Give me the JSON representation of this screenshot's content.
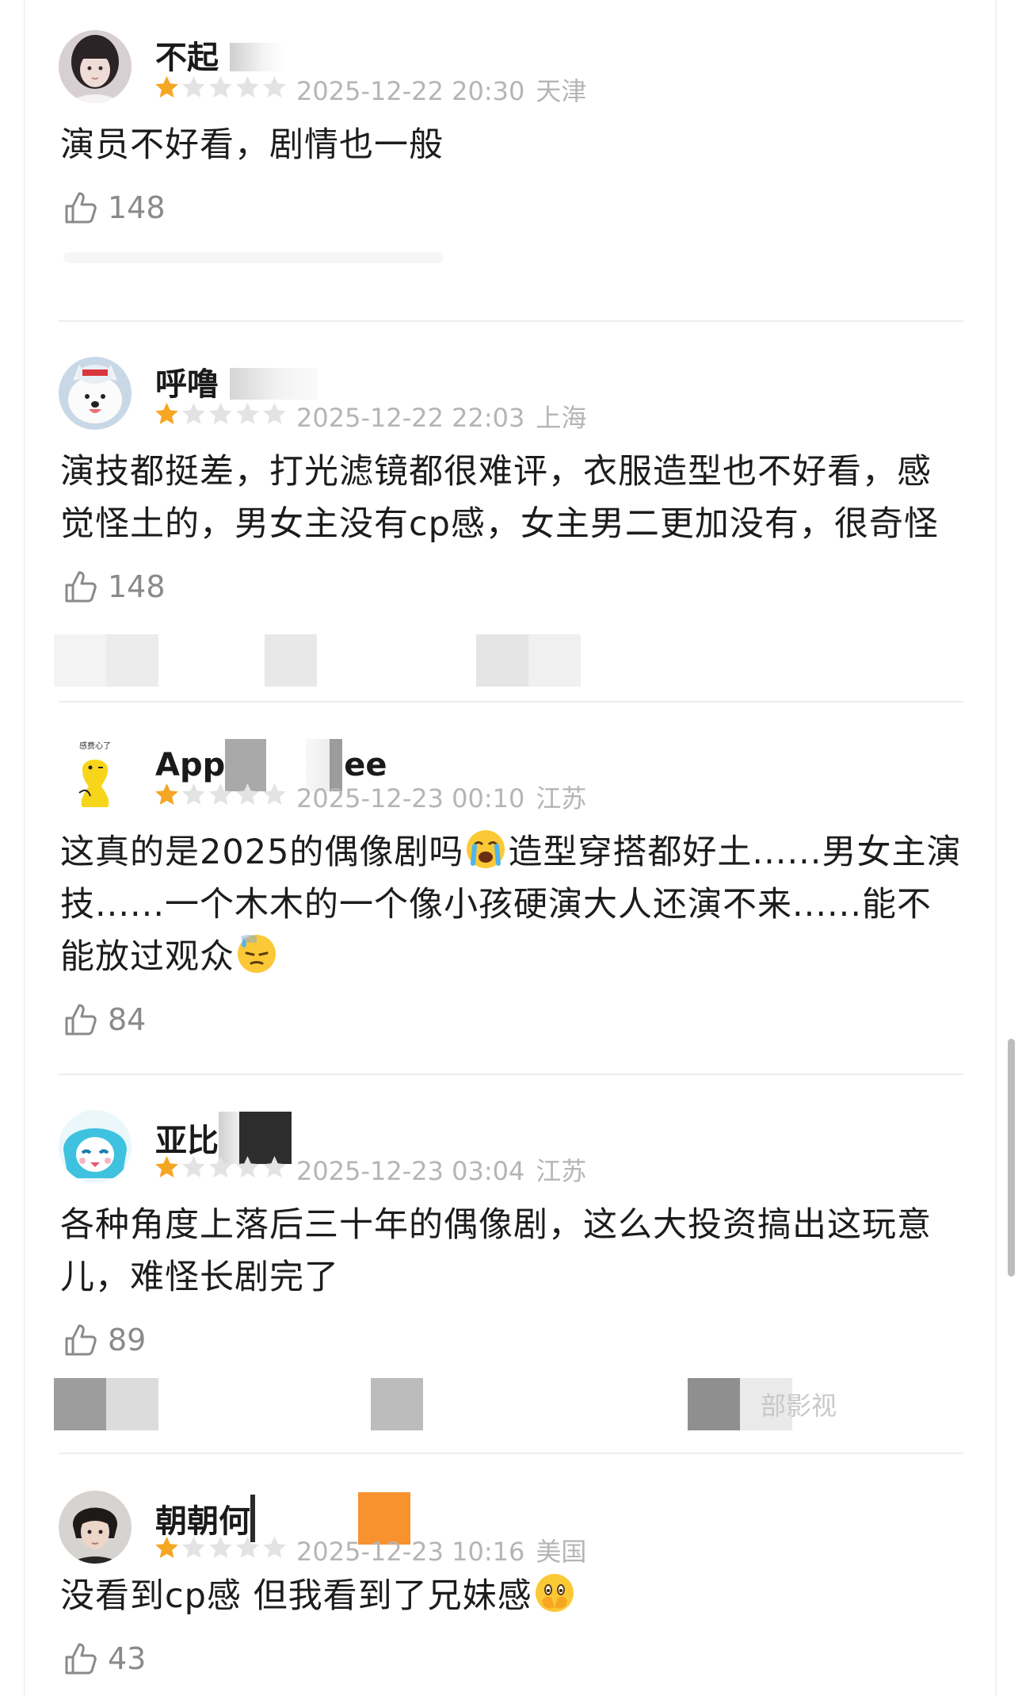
{
  "colors": {
    "star_filled": "#f5a623",
    "star_empty": "#e3e3e3",
    "meta_gray": "#b5b5b5",
    "like_gray": "#8a8a8a",
    "text": "#1c1c1c",
    "divider": "#eeeeee",
    "mosaic_orange": "#f7922e"
  },
  "comments": [
    {
      "username": "不起",
      "rating": 1,
      "date": "2025-12-22 20:30",
      "location": "天津",
      "text": "演员不好看，剧情也一般",
      "likes": "148",
      "avatar_icon": "girl-portrait-avatar"
    },
    {
      "username": "呼噜",
      "rating": 1,
      "date": "2025-12-22 22:03",
      "location": "上海",
      "text": "演技都挺差，打光滤镜都很难评，衣服造型也不好看，感觉怪土的，男女主没有cp感，女主男二更加没有，很奇怪",
      "likes": "148",
      "avatar_icon": "samoyed-dog-avatar"
    },
    {
      "username": "App",
      "username_tail": "ee",
      "rating": 1,
      "date": "2025-12-23 00:10",
      "location": "江苏",
      "text_parts": [
        "这真的是2025的偶像剧吗",
        "造型穿搭都好土......男女主演技......一个木木的一个像小孩硬演大人还演不来......能不能放过观众"
      ],
      "likes": "84",
      "avatar_icon": "yellow-cartoon-avatar",
      "avatar_caption": "感费心了"
    },
    {
      "username": "亚比",
      "rating": 1,
      "date": "2025-12-23 03:04",
      "location": "江苏",
      "text": "各种角度上落后三十年的偶像剧，这么大投资搞出这玩意儿，难怪长剧完了",
      "likes": "89",
      "avatar_icon": "blue-anime-avatar"
    },
    {
      "username": "朝朝何",
      "rating": 1,
      "date": "2025-12-23 10:16",
      "location": "美国",
      "text": "没看到cp感 但我看到了兄妹感",
      "likes": "43",
      "avatar_icon": "man-portrait-avatar"
    }
  ],
  "blurred_row": {
    "partial_text": "部影视"
  }
}
